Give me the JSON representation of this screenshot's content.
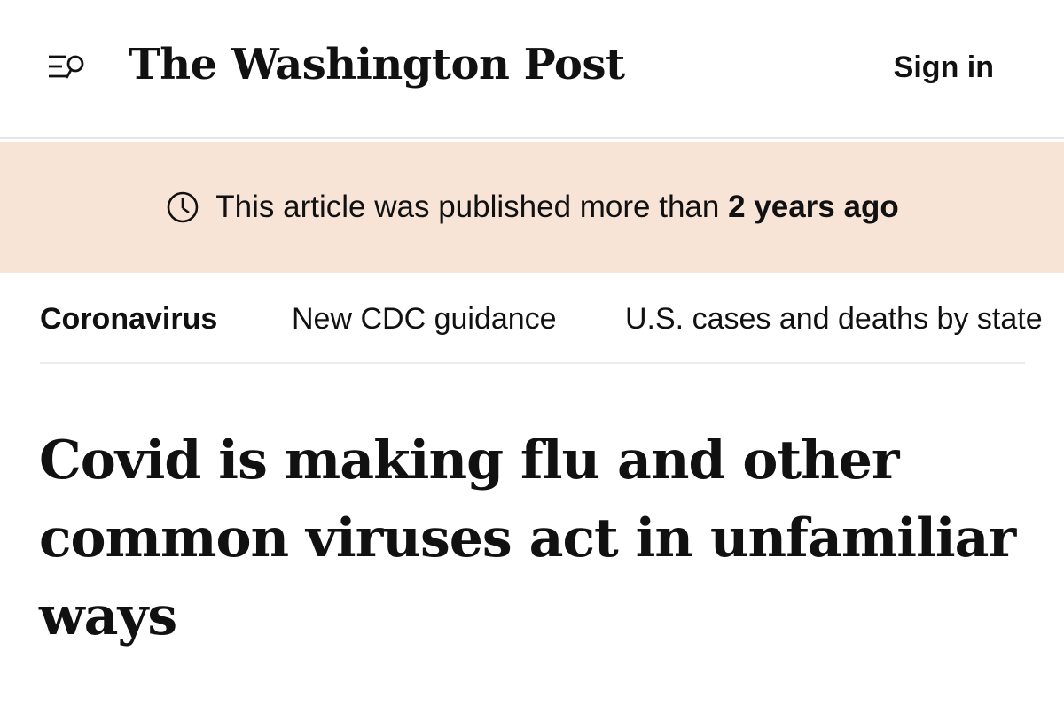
{
  "header": {
    "logo_text": "The Washington Post",
    "sign_in_label": "Sign in",
    "menu_icon": "menu-search-icon"
  },
  "banner": {
    "icon": "clock-icon",
    "text_prefix": "This article was published more than ",
    "text_emphasis": "2 years ago"
  },
  "section_nav": {
    "items": [
      {
        "label": "Coronavirus",
        "active": true
      },
      {
        "label": "New CDC guidance",
        "active": false
      },
      {
        "label": "U.S. cases and deaths by state",
        "active": false
      }
    ]
  },
  "article": {
    "headline": "Covid is making flu and other common viruses act in unfamiliar ways"
  },
  "colors": {
    "banner_background": "#f8e4d7",
    "text": "#111111",
    "divider": "#e6e6e6"
  }
}
